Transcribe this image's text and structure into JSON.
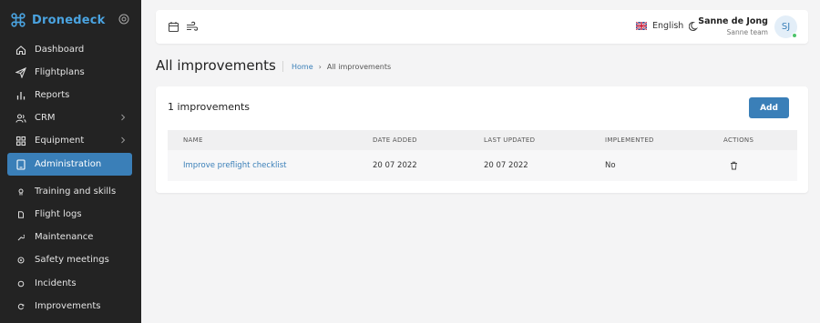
{
  "brand": {
    "name": "Dronedeck",
    "accent": "#4aa3e0"
  },
  "sidebar": {
    "items": [
      {
        "label": "Dashboard",
        "icon": "home-icon"
      },
      {
        "label": "Flightplans",
        "icon": "paper-plane-icon"
      },
      {
        "label": "Reports",
        "icon": "bar-chart-icon"
      },
      {
        "label": "CRM",
        "icon": "users-icon",
        "has_submenu": true
      },
      {
        "label": "Equipment",
        "icon": "grid-icon",
        "has_submenu": true
      },
      {
        "label": "Administration",
        "icon": "tablet-icon",
        "active": true
      },
      {
        "label": "Training and skills",
        "icon": "badge-icon"
      },
      {
        "label": "Flight logs",
        "icon": "file-icon"
      },
      {
        "label": "Maintenance",
        "icon": "wrench-icon"
      },
      {
        "label": "Safety meetings",
        "icon": "shield-icon"
      },
      {
        "label": "Incidents",
        "icon": "circle-icon"
      },
      {
        "label": "Improvements",
        "icon": "refresh-icon"
      }
    ]
  },
  "topbar": {
    "language": "English",
    "user_name": "Sanne de Jong",
    "user_team": "Sanne team",
    "avatar_initials": "SJ"
  },
  "page": {
    "title": "All improvements",
    "breadcrumb": {
      "home": "Home",
      "current": "All improvements"
    }
  },
  "card": {
    "count_label": "1 improvements",
    "add_label": "Add",
    "columns": [
      "NAME",
      "DATE ADDED",
      "LAST UPDATED",
      "IMPLEMENTED",
      "ACTIONS"
    ],
    "rows": [
      {
        "name": "Improve preflight checklist",
        "date_added": "20 07 2022",
        "last_updated": "20 07 2022",
        "implemented": "No"
      }
    ]
  },
  "colors": {
    "primary": "#3a7fb8",
    "sidebar_bg": "#232323",
    "online": "#4cc36b"
  }
}
